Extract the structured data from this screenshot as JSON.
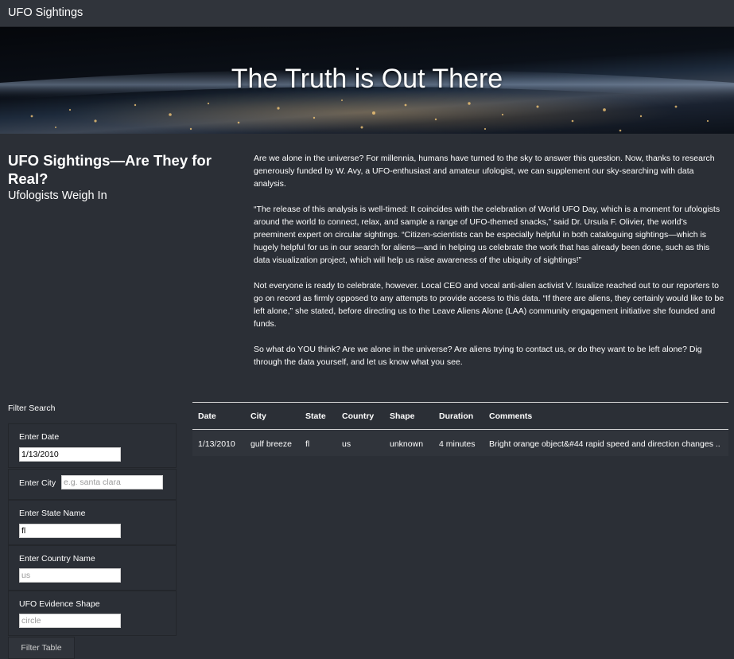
{
  "navbar": {
    "brand": "UFO Sightings"
  },
  "hero": {
    "title": "The Truth is Out There"
  },
  "intro": {
    "heading": "UFO Sightings—Are They for Real?",
    "subheading": "Ufologists Weigh In"
  },
  "article": {
    "paragraphs": [
      "Are we alone in the universe? For millennia, humans have turned to the sky to answer this question. Now, thanks to research generously funded by W. Avy, a UFO-enthusiast and amateur ufologist, we can supplement our sky-searching with data analysis.",
      "“The release of this analysis is well-timed: It coincides with the celebration of World UFO Day, which is a moment for ufologists around the world to connect, relax, and sample a range of UFO-themed snacks,” said Dr. Ursula F. Olivier, the world’s preeminent expert on circular sightings. “Citizen-scientists can be especially helpful in both cataloguing sightings—which is hugely helpful for us in our search for aliens—and in helping us celebrate the work that has already been done, such as this data visualization project, which will help us raise awareness of the ubiquity of sightings!”",
      "Not everyone is ready to celebrate, however. Local CEO and vocal anti-alien activist V. Isualize reached out to our reporters to go on record as firmly opposed to any attempts to provide access to this data. “If there are aliens, they certainly would like to be left alone,” she stated, before directing us to the Leave Aliens Alone (LAA) community engagement initiative she founded and funds.",
      "So what do YOU think? Are we alone in the universe? Are aliens trying to contact us, or do they want to be left alone? Dig through the data yourself, and let us know what you see."
    ]
  },
  "filters": {
    "title": "Filter Search",
    "date": {
      "label": "Enter Date",
      "value": "1/13/2010",
      "placeholder": "1/13/2010"
    },
    "city": {
      "label": "Enter City",
      "value": "",
      "placeholder": "e.g. santa clara"
    },
    "state": {
      "label": "Enter State Name",
      "value": "fl",
      "placeholder": ""
    },
    "country": {
      "label": "Enter Country Name",
      "value": "",
      "placeholder": "us"
    },
    "shape": {
      "label": "UFO Evidence Shape",
      "value": "",
      "placeholder": "circle"
    },
    "button": "Filter Table"
  },
  "table": {
    "headers": [
      "Date",
      "City",
      "State",
      "Country",
      "Shape",
      "Duration",
      "Comments"
    ],
    "rows": [
      [
        "1/13/2010",
        "gulf breeze",
        "fl",
        "us",
        "unknown",
        "4 minutes",
        "Bright orange object&#44 rapid speed and direction changes .."
      ]
    ]
  }
}
